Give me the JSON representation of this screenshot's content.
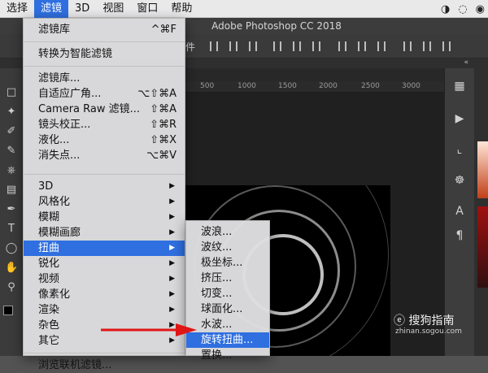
{
  "menubar": {
    "items": [
      "选择",
      "滤镜",
      "3D",
      "视图",
      "窗口",
      "帮助"
    ],
    "active_index": 1
  },
  "window": {
    "title": "Adobe Photoshop CC 2018"
  },
  "options_bar": {
    "partial_label": "件"
  },
  "filter_menu": {
    "top_rows": [
      {
        "label": "滤镜库",
        "shortcut": "^⌘F"
      },
      {
        "label": "转换为智能滤镜",
        "shortcut": ""
      }
    ],
    "group2": [
      {
        "label": "滤镜库...",
        "shortcut": ""
      },
      {
        "label": "自适应广角...",
        "shortcut": "⌥⇧⌘A"
      },
      {
        "label": "Camera Raw 滤镜...",
        "shortcut": "⇧⌘A"
      },
      {
        "label": "镜头校正...",
        "shortcut": "⇧⌘R"
      },
      {
        "label": "液化...",
        "shortcut": "⇧⌘X"
      },
      {
        "label": "消失点...",
        "shortcut": "⌥⌘V"
      }
    ],
    "submenus": [
      {
        "label": "3D"
      },
      {
        "label": "风格化"
      },
      {
        "label": "模糊"
      },
      {
        "label": "模糊画廊"
      },
      {
        "label": "扭曲",
        "active": true
      },
      {
        "label": "锐化"
      },
      {
        "label": "视频"
      },
      {
        "label": "像素化"
      },
      {
        "label": "渲染"
      },
      {
        "label": "杂色"
      },
      {
        "label": "其它"
      }
    ],
    "bottom": {
      "label": "浏览联机滤镜..."
    },
    "submenu_arrow": "▶"
  },
  "distort_menu": {
    "items": [
      {
        "label": "波浪..."
      },
      {
        "label": "波纹..."
      },
      {
        "label": "极坐标..."
      },
      {
        "label": "挤压..."
      },
      {
        "label": "切变..."
      },
      {
        "label": "球面化..."
      },
      {
        "label": "水波..."
      },
      {
        "label": "旋转扭曲...",
        "active": true
      },
      {
        "label": "置换..."
      }
    ]
  },
  "watermark": {
    "text": "搜狗指南",
    "url": "zhinan.sogou.com"
  },
  "colors": {
    "accent": "#2f6fe0",
    "arrow": "#e01515"
  }
}
